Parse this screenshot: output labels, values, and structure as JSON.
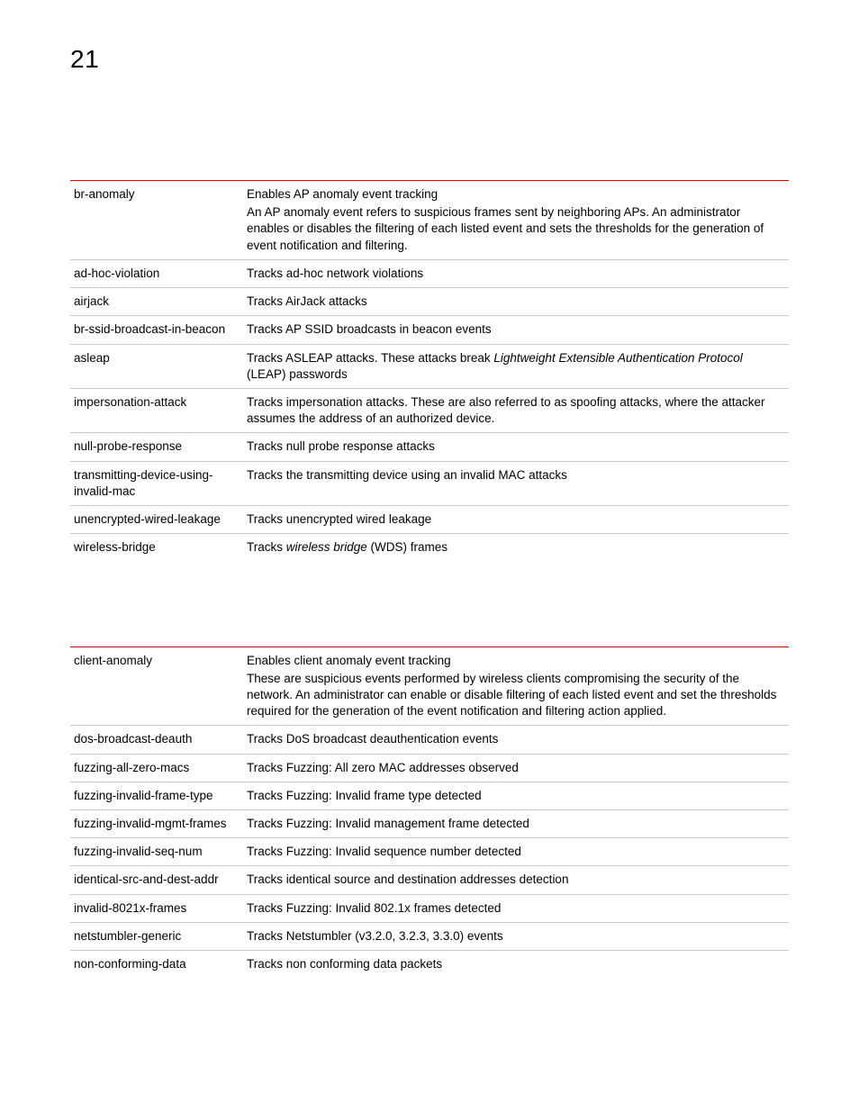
{
  "page_number": "21",
  "table1": {
    "rows": [
      {
        "term": "br-anomaly",
        "desc_line1": "Enables AP anomaly event tracking",
        "desc_para": "An AP anomaly event refers to suspicious frames sent by neighboring APs. An administrator enables or disables the filtering of each listed event and sets the thresholds for the generation of event notification and filtering."
      },
      {
        "term": "ad-hoc-violation",
        "desc_line1": "Tracks ad-hoc network violations"
      },
      {
        "term": "airjack",
        "desc_line1": "Tracks AirJack attacks"
      },
      {
        "term": "br-ssid-broadcast-in-beacon",
        "desc_line1": "Tracks AP SSID broadcasts in beacon events"
      },
      {
        "term": "asleap",
        "desc_prefix": "Tracks ASLEAP attacks. These attacks break ",
        "desc_italic": "Lightweight Extensible Authentication Protocol",
        "desc_suffix": " (LEAP) passwords"
      },
      {
        "term": "impersonation-attack",
        "desc_line1": "Tracks impersonation attacks. These are also referred to as spoofing attacks, where the attacker assumes the address of an authorized device."
      },
      {
        "term": "null-probe-response",
        "desc_line1": "Tracks null probe response attacks"
      },
      {
        "term": "transmitting-device-using-invalid-mac",
        "desc_line1": "Tracks the transmitting device using an invalid MAC attacks"
      },
      {
        "term": "unencrypted-wired-leakage",
        "desc_line1": "Tracks unencrypted wired leakage"
      },
      {
        "term": "wireless-bridge",
        "desc_prefix": "Tracks ",
        "desc_italic": "wireless bridge",
        "desc_suffix": " (WDS) frames"
      }
    ]
  },
  "table2": {
    "rows": [
      {
        "term": "client-anomaly",
        "desc_line1": "Enables client anomaly event tracking",
        "desc_para": "These are suspicious events performed by wireless clients compromising the security of the network. An administrator can enable or disable filtering of each listed event and set the thresholds required for the generation of the event notification and filtering action applied."
      },
      {
        "term": "dos-broadcast-deauth",
        "desc_line1": "Tracks DoS broadcast deauthentication events"
      },
      {
        "term": "fuzzing-all-zero-macs",
        "desc_line1": "Tracks Fuzzing: All zero MAC addresses observed"
      },
      {
        "term": "fuzzing-invalid-frame-type",
        "desc_line1": "Tracks Fuzzing: Invalid frame type detected"
      },
      {
        "term": "fuzzing-invalid-mgmt-frames",
        "desc_line1": "Tracks Fuzzing: Invalid management frame detected"
      },
      {
        "term": "fuzzing-invalid-seq-num",
        "desc_line1": "Tracks Fuzzing: Invalid sequence number detected"
      },
      {
        "term": "identical-src-and-dest-addr",
        "desc_line1": "Tracks identical source and destination addresses detection"
      },
      {
        "term": "invalid-8021x-frames",
        "desc_line1": "Tracks Fuzzing: Invalid 802.1x frames detected"
      },
      {
        "term": "netstumbler-generic",
        "desc_line1": "Tracks Netstumbler (v3.2.0, 3.2.3, 3.3.0) events"
      },
      {
        "term": "non-conforming-data",
        "desc_line1": "Tracks non conforming data packets"
      }
    ]
  }
}
